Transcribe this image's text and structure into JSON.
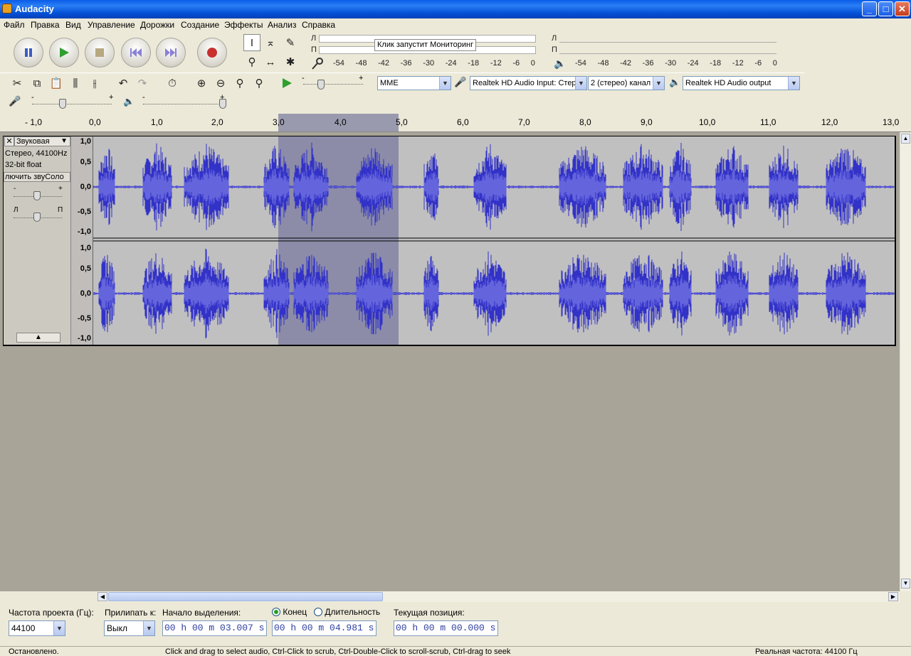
{
  "window": {
    "title": "Audacity",
    "minimize": "_",
    "maximize": "□",
    "close": "✕"
  },
  "menu": [
    "Файл",
    "Правка",
    "Вид",
    "Управление",
    "Дорожки",
    "Создание",
    "Эффекты",
    "Анализ",
    "Справка"
  ],
  "meters": {
    "record": {
      "left_ch": "Л",
      "right_ch": "П",
      "tooltip": "Клик запустит Мониторинг",
      "scale": [
        "-54",
        "-48",
        "-42",
        "-36",
        "-30",
        "-24",
        "-18",
        "-12",
        "-6",
        "0"
      ]
    },
    "play": {
      "left_ch": "Л",
      "right_ch": "П",
      "scale": [
        "-54",
        "-48",
        "-42",
        "-36",
        "-30",
        "-24",
        "-18",
        "-12",
        "-6",
        "0"
      ]
    }
  },
  "device": {
    "host": "MME",
    "input": "Realtek HD Audio Input: Стер",
    "channels": "2 (стерео) канал",
    "output": "Realtek HD Audio output"
  },
  "mixer": {
    "minus": "-",
    "plus": "+"
  },
  "ruler": [
    "- 1,0",
    "0,0",
    "1,0",
    "2,0",
    "3,0",
    "4,0",
    "5,0",
    "6,0",
    "7,0",
    "8,0",
    "9,0",
    "10,0",
    "11,0",
    "12,0",
    "13,0"
  ],
  "track": {
    "name": "Звуковая",
    "info1": "Стерео, 44100Hz",
    "info2": "32-bit float",
    "mute_solo": "лючить звуСоло",
    "gain_minus": "-",
    "gain_plus": "+",
    "pan_left": "Л",
    "pan_right": "П",
    "amp_labels": [
      "1,0",
      "0,5",
      "0,0",
      "-0,5",
      "-1,0"
    ],
    "selection_start": 3.007,
    "selection_end": 4.981
  },
  "bottom": {
    "rate_label": "Частота проекта (Гц):",
    "rate_value": "44100",
    "snap_label": "Прилипать к:",
    "snap_value": "Выкл",
    "sel_start_label": "Начало выделения:",
    "end_label": "Конец",
    "length_label": "Длительность",
    "sel_start": "00 h 00 m 03.007 s",
    "sel_end": "00 h 00 m 04.981 s",
    "pos_label": "Текущая позиция:",
    "pos": "00 h 00 m 00.000 s"
  },
  "status": {
    "state": "Остановлено.",
    "hint": "Click and drag to select audio, Ctrl-Click to scrub, Ctrl-Double-Click to scroll-scrub, Ctrl-drag to seek",
    "rate": "Реальная частота: 44100 Гц"
  },
  "colors": {
    "wave": "#3232c8",
    "wave_light": "#6464dc",
    "selection": "#8c8ca8",
    "titlebar": "#0a5ce8"
  },
  "icons": [
    "pause-icon",
    "play-icon",
    "stop-icon",
    "skip-start-icon",
    "skip-end-icon",
    "record-icon",
    "select-tool-icon",
    "envelope-tool-icon",
    "draw-tool-icon",
    "zoom-tool-icon",
    "timeshift-tool-icon",
    "multi-tool-icon",
    "microphone-icon",
    "speaker-icon",
    "cut-icon",
    "copy-icon",
    "paste-icon",
    "trim-icon",
    "silence-icon",
    "undo-icon",
    "redo-icon",
    "sync-lock-icon",
    "zoom-in-icon",
    "zoom-out-icon",
    "fit-selection-icon",
    "fit-project-icon"
  ]
}
